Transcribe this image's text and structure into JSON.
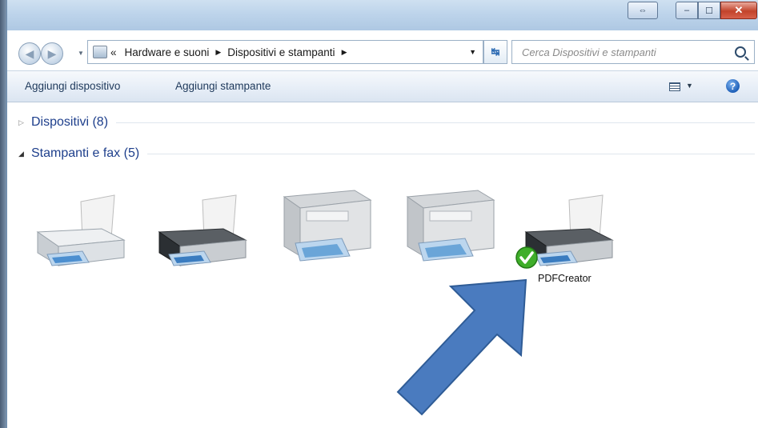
{
  "window": {
    "buttons": {
      "extra": "⇔",
      "minimize": "–",
      "maximize": "☐",
      "close": "✕"
    }
  },
  "address": {
    "overflow": "«",
    "crumbs": [
      "Hardware e suoni",
      "Dispositivi e stampanti"
    ],
    "search_placeholder": "Cerca Dispositivi e stampanti"
  },
  "commands": {
    "add_device": "Aggiungi dispositivo",
    "add_printer": "Aggiungi stampante"
  },
  "groups": {
    "devices": "Dispositivi (8)",
    "printers": "Stampanti e fax (5)"
  },
  "printers": [
    {
      "icon": "inkjet-printer-white-icon"
    },
    {
      "icon": "inkjet-printer-black-icon"
    },
    {
      "icon": "multifunction-printer-icon"
    },
    {
      "icon": "multifunction-printer-icon"
    },
    {
      "icon": "inkjet-printer-black-icon",
      "label": "PDFCreator",
      "default": true
    }
  ],
  "colors": {
    "group_title": "#1e3f8c",
    "arrow_fill": "#4a7bbf",
    "default_check": "#3fae2a"
  }
}
